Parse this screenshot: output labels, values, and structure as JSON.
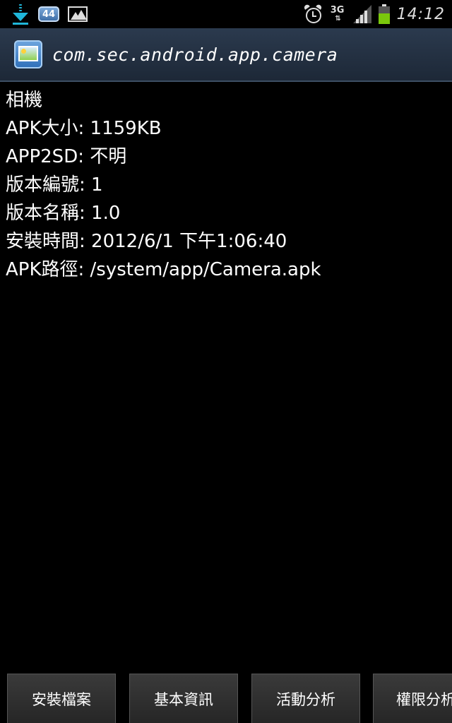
{
  "status_bar": {
    "notification_badge": "44",
    "network_type": "3G",
    "network_arrows": "⇅",
    "battery_level_percent": 60,
    "time": "14:12",
    "icons": [
      "download-icon",
      "badge-icon",
      "gallery-icon",
      "alarm-icon",
      "network-3g-icon",
      "signal-icon",
      "battery-icon"
    ]
  },
  "title_bar": {
    "title": "com.sec.android.app.camera",
    "icon": "app-icon"
  },
  "app_info": {
    "lines": [
      "相機",
      "APK大小: 1159KB",
      "APP2SD: 不明",
      "版本編號: 1",
      "版本名稱: 1.0",
      "安裝時間: 2012/6/1 下午1:06:40",
      "APK路徑: /system/app/Camera.apk"
    ]
  },
  "tabs": [
    {
      "label": "安裝檔案"
    },
    {
      "label": "基本資訊"
    },
    {
      "label": "活動分析"
    },
    {
      "label": "權限分析"
    }
  ],
  "colors": {
    "background": "#000000",
    "title_bar": "#2b3a4e",
    "download_accent": "#1fb6d9",
    "battery_fill": "#7ac70c",
    "tab_background": "#333333"
  }
}
